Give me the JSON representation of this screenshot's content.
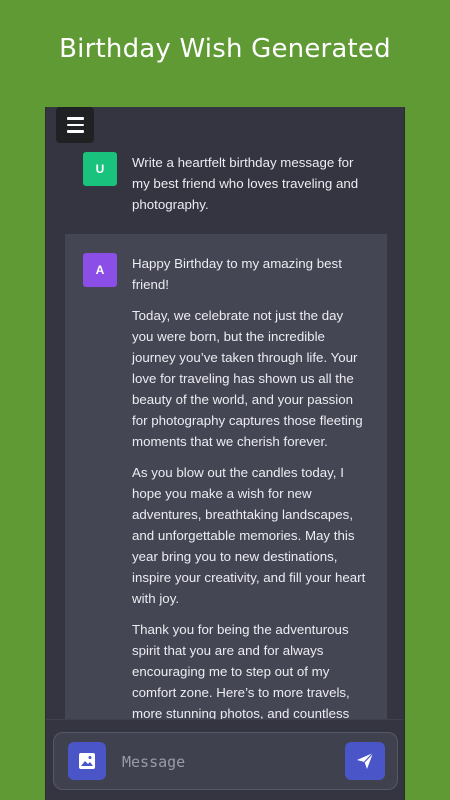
{
  "banner": {
    "title": "Birthday Wish Generated"
  },
  "chat": {
    "user": {
      "avatar_letter": "U",
      "text": "Write a heartfelt birthday message for my best friend who loves traveling and photography."
    },
    "assistant": {
      "avatar_letter": "A",
      "paragraphs": [
        "Happy Birthday to my amazing best friend!",
        "Today, we celebrate not just the day you were born, but the incredible journey you’ve taken through life. Your love for traveling has shown us all the beauty of the world, and your passion for photography captures those fleeting moments that we cherish forever.",
        "As you blow out the candles today, I hope you make a wish for new adventures, breathtaking landscapes, and unforgettable memories. May this year bring you to new destinations, inspire your creativity, and fill your heart with joy.",
        "Thank you for being the adventurous spirit that you are and for always encouraging me to step out of my comfort zone. Here’s to more travels, more stunning photos, and countless"
      ]
    }
  },
  "composer": {
    "placeholder": "Message"
  },
  "colors": {
    "background": "#5f9a35",
    "chat_bg": "#343541",
    "assistant_bg": "#444654",
    "user_avatar": "#19c37d",
    "assistant_avatar": "#8b4ee6",
    "accent": "#4a55c8"
  },
  "icons": {
    "menu": "hamburger-icon",
    "image": "image-icon",
    "send": "send-icon"
  }
}
